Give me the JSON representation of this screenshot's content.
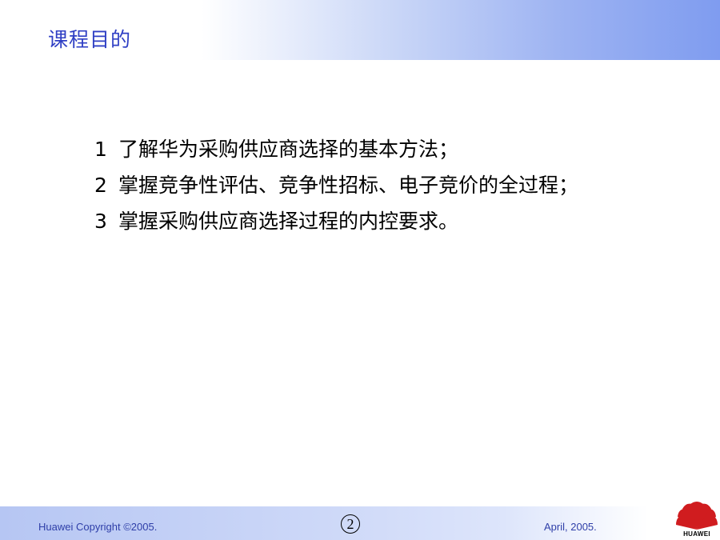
{
  "slide": {
    "title": "课程目的",
    "objectives": [
      {
        "number": "1",
        "text": "了解华为采购供应商选择的基本方法；"
      },
      {
        "number": "2",
        "text": "掌握竞争性评估、竞争性招标、电子竞价的全过程；"
      },
      {
        "number": "3",
        "text": "掌握采购供应商选择过程的内控要求。"
      }
    ]
  },
  "footer": {
    "copyright": "Huawei Copyright ©2005.",
    "page_number": "2",
    "date": "April, 2005.",
    "logo_text": "HUAWEI",
    "logo_icon": "huawei-flower-icon"
  },
  "colors": {
    "title": "#2f3fc4",
    "footer_text": "#2e3ea8",
    "logo_red": "#d01c1f",
    "header_gradient_end": "#7f9cf0"
  }
}
